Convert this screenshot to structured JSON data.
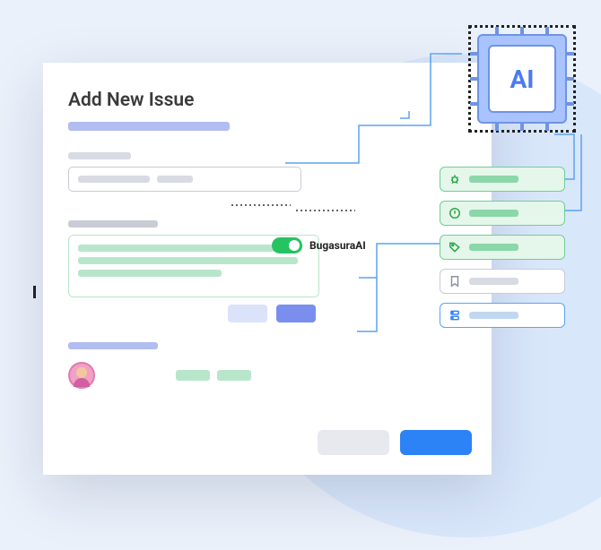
{
  "page": {
    "title": "Add New Issue"
  },
  "ai_toggle": {
    "label": "BugasuraAI",
    "on": true
  },
  "ai_chip": {
    "label": "AI"
  },
  "suggestions": [
    {
      "icon": "bug-icon",
      "kind": "green"
    },
    {
      "icon": "alert-icon",
      "kind": "green"
    },
    {
      "icon": "tag-icon",
      "kind": "green"
    },
    {
      "icon": "bookmark-icon",
      "kind": "gray"
    },
    {
      "icon": "database-icon",
      "kind": "blue"
    }
  ],
  "colors": {
    "brand_blue": "#2c83f6",
    "ai_green": "#26c362",
    "accent_lav": "#b2bdf2"
  }
}
